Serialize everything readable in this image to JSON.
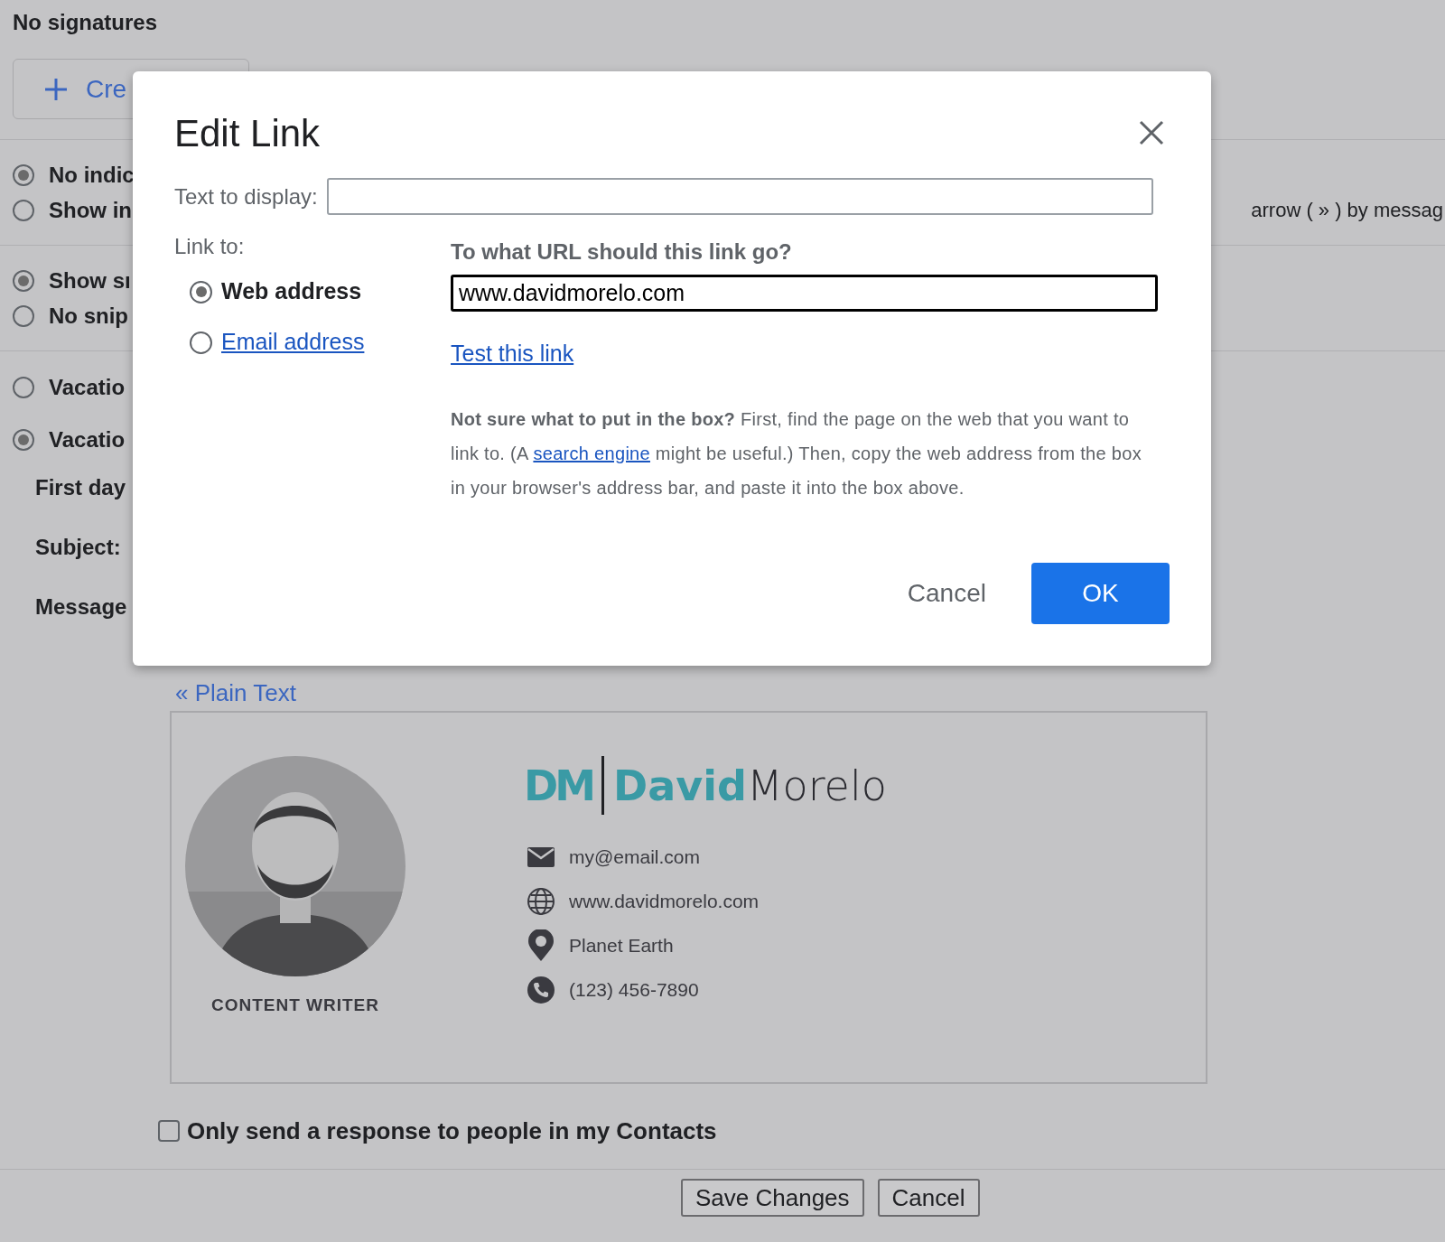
{
  "background": {
    "heading": "No signatures",
    "create_button": {
      "label": "Cre"
    },
    "sections": [
      {
        "options": [
          {
            "label": "No indic",
            "selected": true
          },
          {
            "label": "Show in",
            "selected": false,
            "note": "arrow ( » ) by messag"
          }
        ]
      },
      {
        "options": [
          {
            "label": "Show sı",
            "selected": true
          },
          {
            "label": "No snip",
            "selected": false
          }
        ]
      }
    ],
    "vacation": {
      "options": [
        {
          "label": "Vacatio",
          "selected": false
        },
        {
          "label": "Vacatio",
          "selected": true
        }
      ],
      "fields": [
        "First day",
        "Subject:",
        "Message"
      ]
    },
    "plain_text_link": "« Plain Text",
    "signature": {
      "role": "CONTENT WRITER",
      "logo": {
        "monogram": "DM",
        "first": "David",
        "last": "Morelo"
      },
      "contacts": [
        {
          "kind": "email",
          "text": "my@email.com"
        },
        {
          "kind": "web",
          "text": "www.davidmorelo.com"
        },
        {
          "kind": "location",
          "text": "Planet Earth"
        },
        {
          "kind": "phone",
          "text": "(123) 456-7890"
        }
      ]
    },
    "contacts_only": {
      "label": "Only send a response to people in my Contacts",
      "checked": false
    },
    "buttons": [
      "Save Changes",
      "Cancel"
    ]
  },
  "dialog": {
    "title": "Edit Link",
    "text_to_display": {
      "label": "Text to display:"
    },
    "link_to": {
      "label": "Link to:",
      "options": [
        {
          "label": "Web address",
          "selected": true
        },
        {
          "label": "Email address",
          "selected": false
        }
      ]
    },
    "url_heading": "To what URL should this link go?",
    "url_value": "www.davidmorelo.com",
    "test_link": "Test this link",
    "help": "**Not sure what to put in the box?** First, find the page on the web that you want to link to. (A ",
    "help_link": "search engine",
    "help_end": " might be useful.) Then, copy the web address from the box in your browser's address bar, and paste it into the box above.",
    "buttons": [
      {
        "label": "Cancel",
        "kind": "text"
      },
      {
        "label": "OK",
        "kind": "primary"
      }
    ]
  }
}
